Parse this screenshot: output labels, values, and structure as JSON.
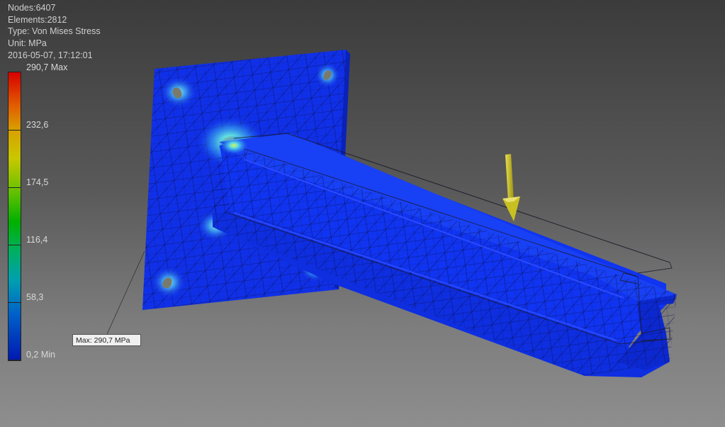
{
  "info": {
    "nodes": "Nodes:6407",
    "elements": "Elements:2812",
    "type": "Type: Von Mises Stress",
    "unit": "Unit: MPa",
    "timestamp": "2016-05-07, 17:12:01"
  },
  "legend": {
    "labels": [
      "290,7 Max",
      "232,6",
      "174,5",
      "116,4",
      "58,3",
      "0,2 Min"
    ]
  },
  "callout": {
    "text": "Max: 290,7 MPa"
  },
  "colors": {
    "mesh_blue": "#1030e8",
    "hotspot_cyan": "#40d0f0",
    "load_arrow": "#c8c020"
  }
}
